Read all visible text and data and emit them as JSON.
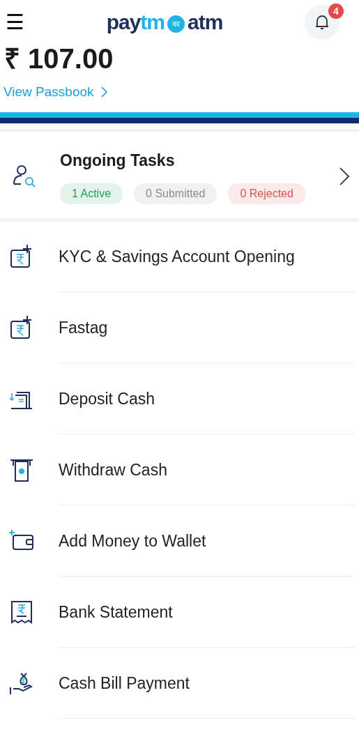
{
  "header": {
    "menu_icon": "☰",
    "logo": {
      "part_1": "pay",
      "part_2": "tm",
      "part_3": "का",
      "part_4": "atm"
    },
    "notification_count": "4"
  },
  "balance": {
    "amount": "₹ 107.00",
    "link": "View Passbook"
  },
  "ongoing_tasks": {
    "title": "Ongoing Tasks",
    "chips": [
      {
        "label": "1 Active",
        "color": "#1f9d5c"
      },
      {
        "label": "0 Submitted",
        "color": "#8a8d93"
      },
      {
        "label": "0 Rejected",
        "color": "#d9534f"
      }
    ]
  },
  "items": [
    {
      "label": "KYC & Savings Account Opening",
      "kind": "rupee-plus"
    },
    {
      "label": "Fastag",
      "kind": "rupee-plus"
    },
    {
      "label": "Deposit Cash",
      "kind": "deposit"
    },
    {
      "label": "Withdraw Cash",
      "kind": "withdraw"
    },
    {
      "label": "Add Money to Wallet",
      "kind": "wallet"
    },
    {
      "label": "Bank Statement",
      "kind": "statement"
    },
    {
      "label": "Cash Bill Payment",
      "kind": "moneybag"
    }
  ]
}
